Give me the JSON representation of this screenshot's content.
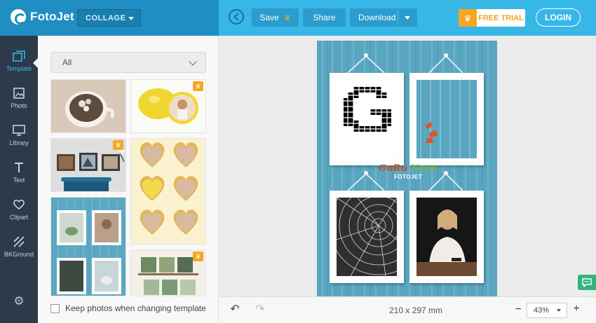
{
  "app": {
    "name": "FotoJet"
  },
  "header": {
    "mode_select": "COLLAGE",
    "save_label": "Save",
    "share_label": "Share",
    "download_label": "Download",
    "free_trial_label": "FREE TRIAL",
    "login_label": "LOGIN"
  },
  "toolbar": {
    "items": [
      {
        "label": "Template",
        "icon": "template-icon"
      },
      {
        "label": "Photo",
        "icon": "photo-icon"
      },
      {
        "label": "Library",
        "icon": "library-icon"
      },
      {
        "label": "Text",
        "icon": "text-icon"
      },
      {
        "label": "Clipart",
        "icon": "heart-icon"
      },
      {
        "label": "BKGround",
        "icon": "background-icon"
      }
    ],
    "active_item": "Template",
    "settings_icon": "gear-icon"
  },
  "template_panel": {
    "filter_value": "All",
    "keep_photos_label": "Keep photos when changing template",
    "keep_photos_checked": false
  },
  "canvas": {
    "watermark_part1": "GuRu",
    "watermark_part2": "News",
    "watermark_sub": "FOTOJET",
    "background_color": "#5aa6c0"
  },
  "footer": {
    "page_size": "210 x 297 mm",
    "zoom_level": "43%"
  },
  "colors": {
    "header_left": "#1f8ec2",
    "header_right": "#37b7e6",
    "toolbar": "#2c3a4a",
    "accent_orange": "#f5a623",
    "chat_green": "#2fb67c"
  }
}
